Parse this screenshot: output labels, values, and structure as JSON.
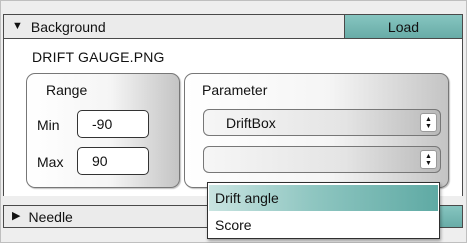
{
  "background_section": {
    "title": "Background",
    "expanded_icon": "triangle-down-icon",
    "load_label": "Load",
    "file_name": "DRIFT GAUGE.PNG"
  },
  "range": {
    "title": "Range",
    "min_label": "Min",
    "min_value": "-90",
    "max_label": "Max",
    "max_value": "90"
  },
  "parameter": {
    "title": "Parameter",
    "select_1_value": "DriftBox",
    "select_2_value": "",
    "dropdown_options": [
      "Drift angle",
      "Score"
    ],
    "highlighted_option": "Drift angle"
  },
  "needle_section": {
    "title": "Needle",
    "collapsed_icon": "triangle-right-icon"
  },
  "colors": {
    "accent_teal": "#6fb3ae",
    "panel_bg": "#ebebeb"
  }
}
